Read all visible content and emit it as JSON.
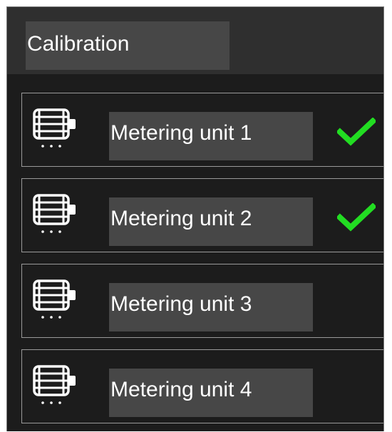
{
  "header": {
    "title": "Calibration"
  },
  "units": [
    {
      "label": "Metering unit 1",
      "icon": "metering-unit-icon",
      "calibrated": true
    },
    {
      "label": "Metering unit 2",
      "icon": "metering-unit-icon",
      "calibrated": true
    },
    {
      "label": "Metering unit 3",
      "icon": "metering-unit-icon",
      "calibrated": false
    },
    {
      "label": "Metering unit 4",
      "icon": "metering-unit-icon",
      "calibrated": false
    }
  ],
  "colors": {
    "panel_background": "#1c1c1c",
    "header_background": "#2f2f2f",
    "field_background": "#474747",
    "row_border": "#9a9a9a",
    "check": "#22dd22",
    "text": "#ffffff"
  }
}
